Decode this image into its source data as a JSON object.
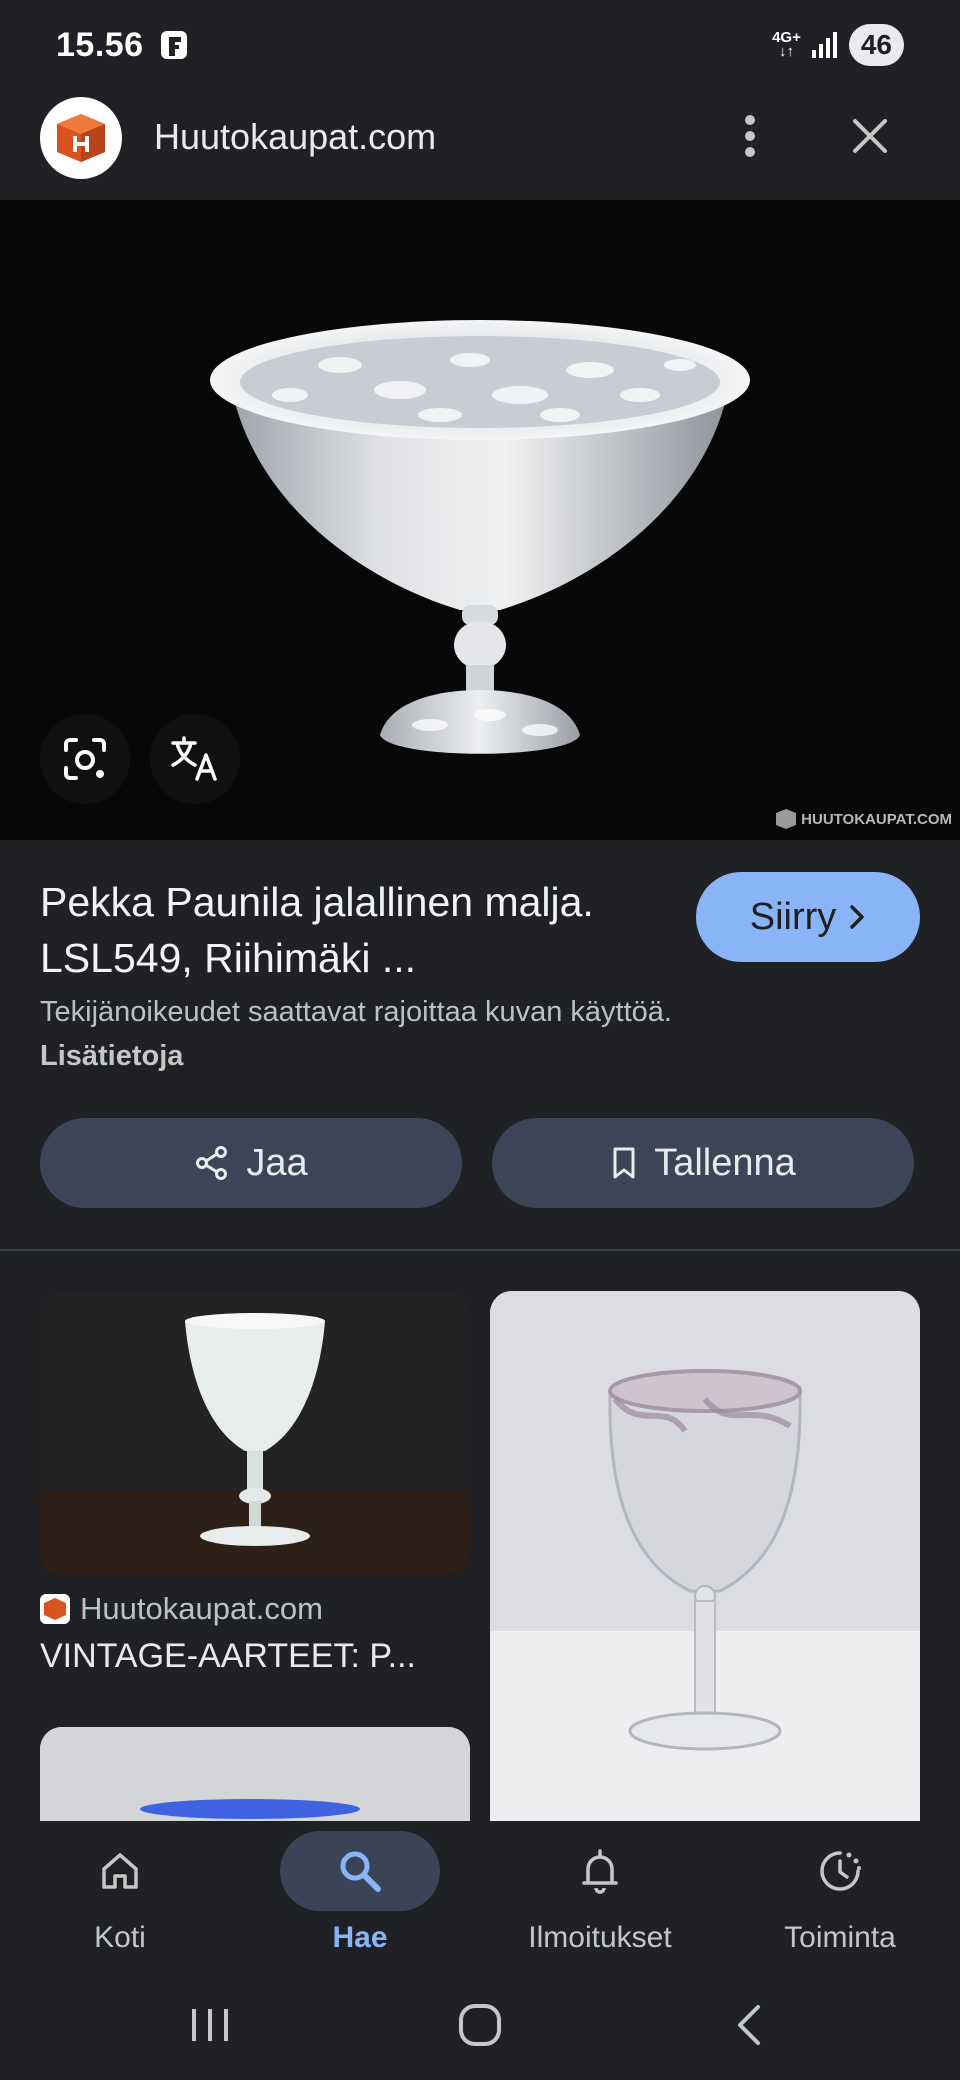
{
  "status_bar": {
    "time": "15.56",
    "network": "4G+",
    "battery": "46"
  },
  "title_bar": {
    "site_name": "Huutokaupat.com"
  },
  "hero": {
    "watermark": "HUUTOKAUPAT.COM"
  },
  "result": {
    "title": "Pekka Paunila jalallinen malja. LSL549, Riihimäki ...",
    "go_label": "Siirry",
    "copyright_text": "Tekijänoikeudet saattavat rajoittaa kuvan käyttöä.",
    "more_link": "Lisätietoja",
    "share_label": "Jaa",
    "save_label": "Tallenna"
  },
  "related": [
    {
      "source": "Huutokaupat.com",
      "title": "VINTAGE-AARTEET: P..."
    }
  ],
  "nav": {
    "items": [
      {
        "label": "Koti",
        "icon": "home-icon"
      },
      {
        "label": "Hae",
        "icon": "search-icon",
        "active": true
      },
      {
        "label": "Ilmoitukset",
        "icon": "bell-icon"
      },
      {
        "label": "Toiminta",
        "icon": "activity-icon"
      }
    ]
  },
  "colors": {
    "background": "#202124",
    "accent": "#8ab4f8",
    "button": "#3c4557",
    "brand_orange": "#d9531e"
  }
}
